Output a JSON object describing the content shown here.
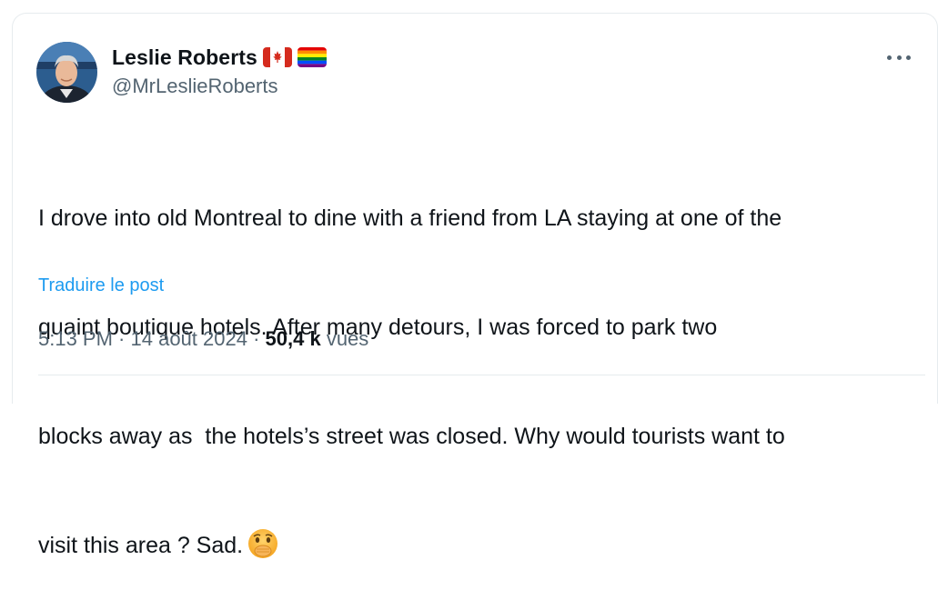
{
  "author": {
    "name": "Leslie Roberts",
    "handle": "@MrLeslieRoberts",
    "flag_icons": [
      "canada-flag-icon",
      "rainbow-flag-icon"
    ]
  },
  "tweet": {
    "lines": [
      "I drove into old Montreal to dine with a friend from LA staying at one of the",
      "quaint boutique hotels. After many detours, I was forced to park two",
      "blocks away as  the hotels’s street was closed. Why would tourists want to",
      "visit this area ? Sad."
    ],
    "emoji": "face-with-hand-over-mouth-icon"
  },
  "translate_label": "Traduire le post",
  "meta": {
    "time": "5:13 PM",
    "sep1": " · ",
    "date": "14 août 2024",
    "sep2": " · ",
    "views_count": "50,4 k",
    "views_label": " vues"
  },
  "colors": {
    "text": "#0f1419",
    "secondary": "#536471",
    "link": "#1d9bf0",
    "border": "#e6ebee"
  }
}
